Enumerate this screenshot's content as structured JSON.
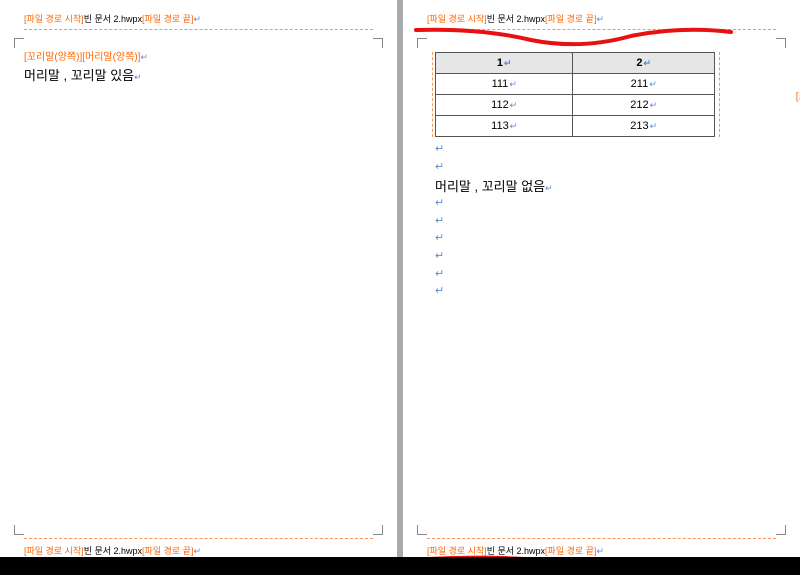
{
  "path_markers": {
    "start": "[파일 경로 시작]",
    "filename": "빈 문서 2.hwpx",
    "end": "[파일 경로 끝]"
  },
  "left_page": {
    "header_tags": "[꼬리말(양쪽)][머리말(양쪽)]",
    "body_line": "머리말 , 꼬리말 있음"
  },
  "right_page": {
    "body_line": "머리말 , 꼬리말 없음",
    "table_label": "[표]",
    "table": {
      "headers": [
        "1",
        "2"
      ],
      "rows": [
        [
          "111",
          "211"
        ],
        [
          "112",
          "212"
        ],
        [
          "113",
          "213"
        ]
      ]
    }
  }
}
